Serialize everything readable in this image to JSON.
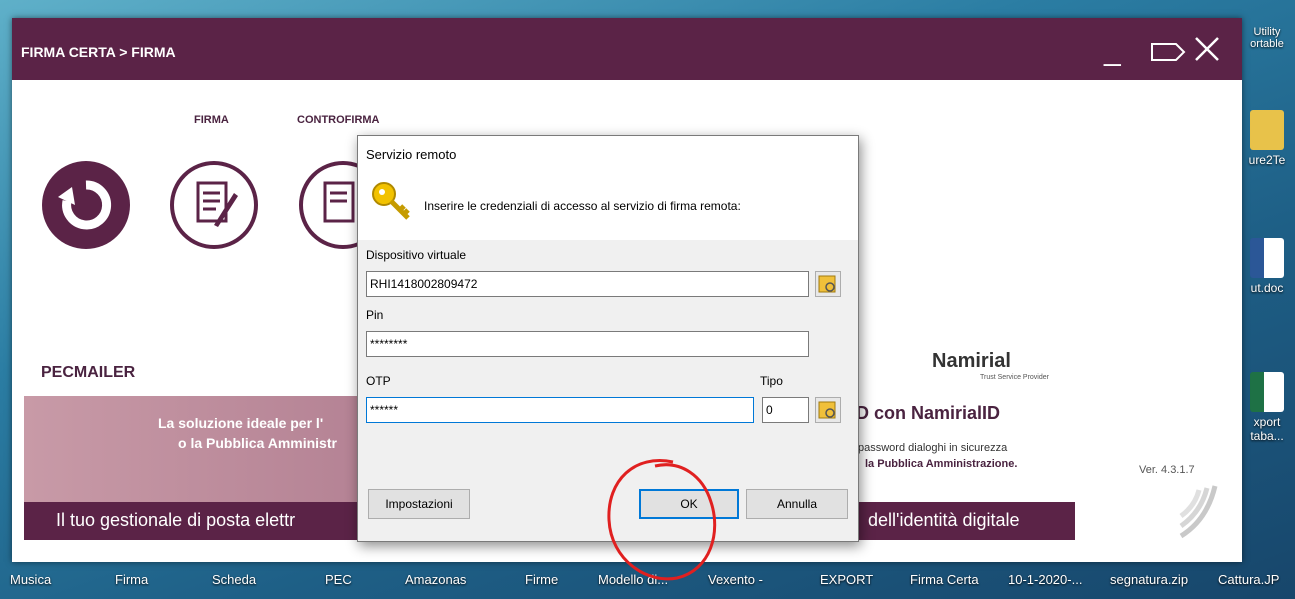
{
  "window": {
    "title": "FIRMA CERTA > FIRMA",
    "tabs": [
      "FIRMA",
      "CONTROFIRMA"
    ]
  },
  "app": {
    "pecmailer": "PECMAILER",
    "banner_line1": "La soluzione ideale per l'",
    "banner_line2": "o la Pubblica Amministr",
    "bottom_left": "Il tuo gestionale di posta elettr",
    "bottom_right": "dell'identità digitale",
    "namirial_logo": "Namirial",
    "namirial_sub": "Trust Service Provider",
    "namirial_id": "D con NamirialID",
    "promo_line1": "password dialoghi in sicurezza",
    "promo_line2": "la Pubblica Amministrazione.",
    "version": "Ver. 4.3.1.7"
  },
  "dialog": {
    "title": "Servizio remoto",
    "message": "Inserire le credenziali di accesso al servizio di firma remota:",
    "device_label": "Dispositivo virtuale",
    "device_value": "RHI1418002809472",
    "pin_label": "Pin",
    "pin_value": "********",
    "otp_label": "OTP",
    "otp_value": "******",
    "tipo_label": "Tipo",
    "tipo_value": "0",
    "settings_button": "Impostazioni",
    "ok_button": "OK",
    "cancel_button": "Annulla"
  },
  "desktop": {
    "icon_labels": [
      "Utility",
      "ortable",
      "ure2Te",
      "ut.doc",
      "xport",
      "taba..."
    ],
    "taskbar_labels": [
      "Musica",
      "Firma",
      "Scheda",
      "PEC",
      "Amazonas",
      "Firme",
      "Modello di...",
      "Vexento -",
      "EXPORT",
      "Firma Certa",
      "10-1-2020-...",
      "segnatura.zip",
      "Cattura.JP"
    ]
  },
  "colors": {
    "brand": "#5b2347",
    "accent": "#0078d7"
  }
}
